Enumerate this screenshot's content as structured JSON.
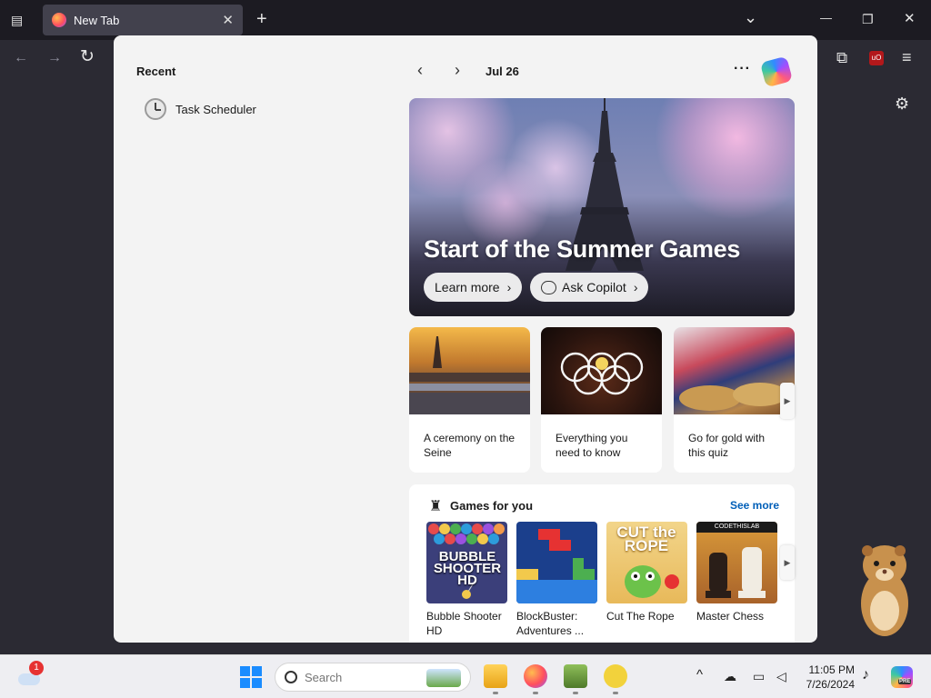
{
  "browser": {
    "tab_title": "New Tab",
    "tab_close": "✕",
    "new_tab": "+",
    "back": "←",
    "forward": "→",
    "reload": "↻",
    "minimize": "—",
    "restore": "❐",
    "close": "✕",
    "list_tabs": "⌄",
    "extensions": "⧉",
    "ublock": "uO",
    "menu": "≡",
    "settings": "⚙"
  },
  "widgets": {
    "recent_title": "Recent",
    "recent_items": [
      {
        "label": "Task Scheduler",
        "icon": "clock-icon"
      }
    ],
    "date": "Jul 26",
    "prev": "‹",
    "next": "›",
    "more": "···",
    "hero": {
      "title": "Start of the Summer Games",
      "learn_more": "Learn more",
      "ask_copilot": "Ask Copilot",
      "arrow": "›"
    },
    "cards": [
      {
        "caption": "A ceremony on the Seine"
      },
      {
        "caption": "Everything you need to know"
      },
      {
        "caption": "Go for gold with this quiz"
      }
    ],
    "card_nav": "▶",
    "games": {
      "title": "Games for you",
      "see_more": "See more",
      "nav": "▶",
      "items": [
        {
          "name": "Bubble Shooter HD",
          "thumb_text": "BUBBLE SHOOTER HD"
        },
        {
          "name": "BlockBuster: Adventures ..."
        },
        {
          "name": "Cut The Rope",
          "thumb_text": "CUT the ROPE"
        },
        {
          "name": "Master Chess",
          "thumb_text": "CODETHISLAB"
        }
      ]
    }
  },
  "taskbar": {
    "weather_badge": "1",
    "search_placeholder": "Search",
    "time": "11:05 PM",
    "date": "7/26/2024",
    "tray_chevron": "^",
    "copilot_badge": "PRE"
  },
  "colors": {
    "accent": "#005fb8",
    "chrome_bg": "#1c1b22",
    "toolbar_bg": "#2b2a33",
    "panel_bg": "#f3f3f3"
  }
}
